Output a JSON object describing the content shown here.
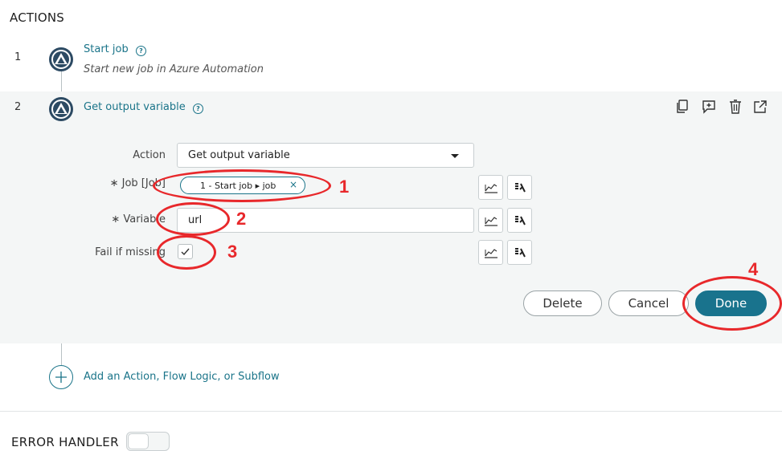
{
  "section_title": "ACTIONS",
  "steps": [
    {
      "number": "1",
      "title": "Start job",
      "subtitle": "Start new job in Azure Automation",
      "help": "?"
    },
    {
      "number": "2",
      "title": "Get output variable",
      "help": "?"
    }
  ],
  "form": {
    "action_label": "Action",
    "action_value": "Get output variable",
    "job_label": "∗ Job [Job]",
    "job_pill": "1 - Start job ▸ job",
    "job_pill_remove": "×",
    "variable_label": "∗ Variable",
    "variable_value": "url",
    "fail_label": "Fail if missing",
    "fail_checked": true
  },
  "buttons": {
    "delete": "Delete",
    "cancel": "Cancel",
    "done": "Done"
  },
  "annotations": [
    "1",
    "2",
    "3",
    "4"
  ],
  "add_action_text": "Add an Action, Flow Logic, or Subflow",
  "error_handler_label": "ERROR HANDLER",
  "toolbar_icons": [
    "copy-icon",
    "comment-add-icon",
    "trash-icon",
    "open-external-icon"
  ],
  "colors": {
    "accent": "#1a7489",
    "primary_button": "#19738d",
    "annotation": "#e8282b",
    "panel_bg": "#f4f6f6"
  }
}
